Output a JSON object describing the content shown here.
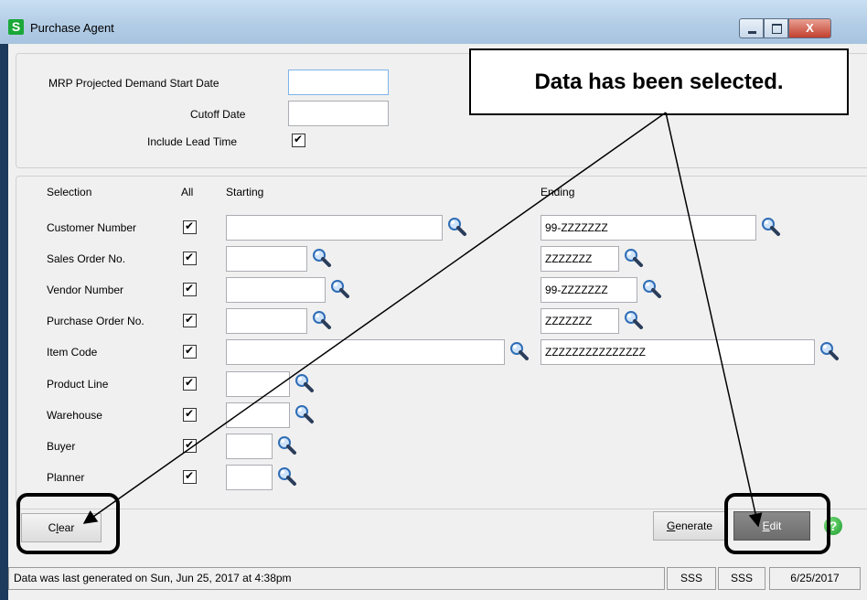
{
  "window": {
    "title": "Purchase Agent",
    "app_icon_letter": "S",
    "close_glyph": "X"
  },
  "mrp": {
    "start_date_label": "MRP Projected Demand Start Date",
    "start_date_value": "",
    "cutoff_label": "Cutoff Date",
    "cutoff_value": "",
    "lead_time_label": "Include Lead Time",
    "lead_time_checked": true
  },
  "selection": {
    "headers": {
      "selection": "Selection",
      "all": "All",
      "starting": "Starting",
      "ending": "Ending"
    },
    "rows": [
      {
        "label": "Customer Number",
        "all": true,
        "starting": "",
        "ending": "99-ZZZZZZZ"
      },
      {
        "label": "Sales Order No.",
        "all": true,
        "starting": "",
        "ending": "ZZZZZZZ"
      },
      {
        "label": "Vendor Number",
        "all": true,
        "starting": "",
        "ending": "99-ZZZZZZZ"
      },
      {
        "label": "Purchase Order No.",
        "all": true,
        "starting": "",
        "ending": "ZZZZZZZ"
      },
      {
        "label": "Item Code",
        "all": true,
        "starting": "",
        "ending": "ZZZZZZZZZZZZZZZ"
      },
      {
        "label": "Product Line",
        "all": true,
        "starting": ""
      },
      {
        "label": "Warehouse",
        "all": true,
        "starting": ""
      },
      {
        "label": "Buyer",
        "all": true,
        "starting": ""
      },
      {
        "label": "Planner",
        "all": true,
        "starting": ""
      }
    ]
  },
  "buttons": {
    "clear": "Clear",
    "generate": "Generate",
    "edit": "Edit",
    "help": "?"
  },
  "status": {
    "message": "Data was last generated on Sun, Jun 25, 2017 at 4:38pm",
    "company": "SSS",
    "user": "SSS",
    "date": "6/25/2017"
  },
  "annotation": {
    "callout": "Data has been selected."
  },
  "icons": [
    "lookup-lens-icon",
    "help-icon",
    "minimize-icon",
    "maximize-icon",
    "close-icon",
    "checkmark-icon"
  ]
}
